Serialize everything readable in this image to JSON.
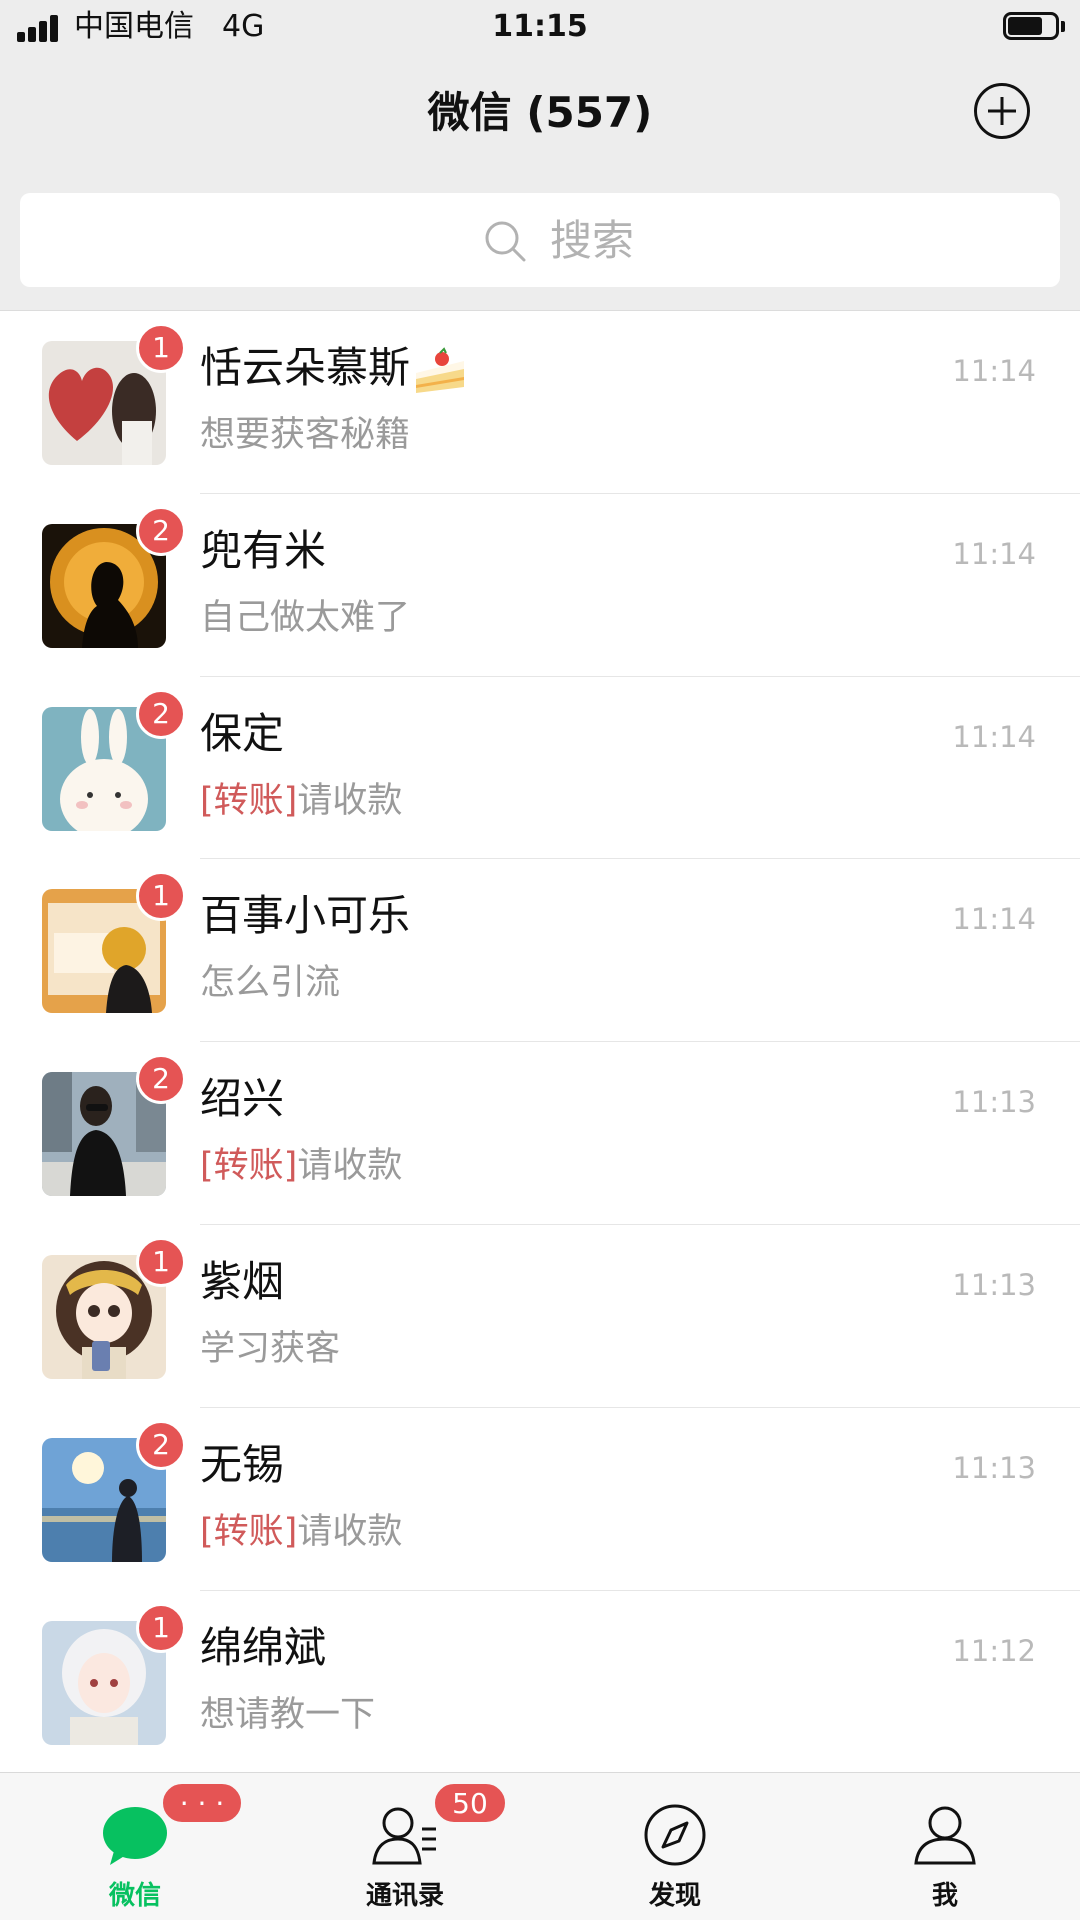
{
  "status_bar": {
    "carrier": "中国电信",
    "network": "4G",
    "time": "11:15"
  },
  "nav": {
    "title": "微信 (557)",
    "add_icon": "plus-circle-icon"
  },
  "search": {
    "placeholder": "搜索",
    "icon": "search-icon"
  },
  "chats": [
    {
      "name": "恬云朵慕斯",
      "name_emoji": "🍰",
      "preview_tag": "",
      "preview": "想要获客秘籍",
      "time": "11:14",
      "unread": "1"
    },
    {
      "name": "兜有米",
      "preview_tag": "",
      "preview": "自己做太难了",
      "time": "11:14",
      "unread": "2"
    },
    {
      "name": "保定",
      "preview_tag": "[转账]",
      "preview": "请收款",
      "time": "11:14",
      "unread": "2"
    },
    {
      "name": "百事小可乐",
      "preview_tag": "",
      "preview": "怎么引流",
      "time": "11:14",
      "unread": "1"
    },
    {
      "name": "绍兴",
      "preview_tag": "[转账]",
      "preview": "请收款",
      "time": "11:13",
      "unread": "2"
    },
    {
      "name": "紫烟",
      "preview_tag": "",
      "preview": "学习获客",
      "time": "11:13",
      "unread": "1"
    },
    {
      "name": "无锡",
      "preview_tag": "[转账]",
      "preview": "请收款",
      "time": "11:13",
      "unread": "2"
    },
    {
      "name": "绵绵斌",
      "preview_tag": "",
      "preview": "想请教一下",
      "time": "11:12",
      "unread": "1"
    }
  ],
  "tabs": [
    {
      "label": "微信",
      "icon": "chat-bubble-icon",
      "badge": "· · ·",
      "active": true
    },
    {
      "label": "通讯录",
      "icon": "contacts-icon",
      "badge": "50",
      "active": false
    },
    {
      "label": "发现",
      "icon": "compass-icon",
      "badge": "",
      "active": false
    },
    {
      "label": "我",
      "icon": "person-icon",
      "badge": "",
      "active": false
    }
  ],
  "colors": {
    "accent_green": "#07c160",
    "badge_red": "#e55454",
    "transfer_tag_red": "#d05a5a",
    "header_bg": "#ededed"
  }
}
